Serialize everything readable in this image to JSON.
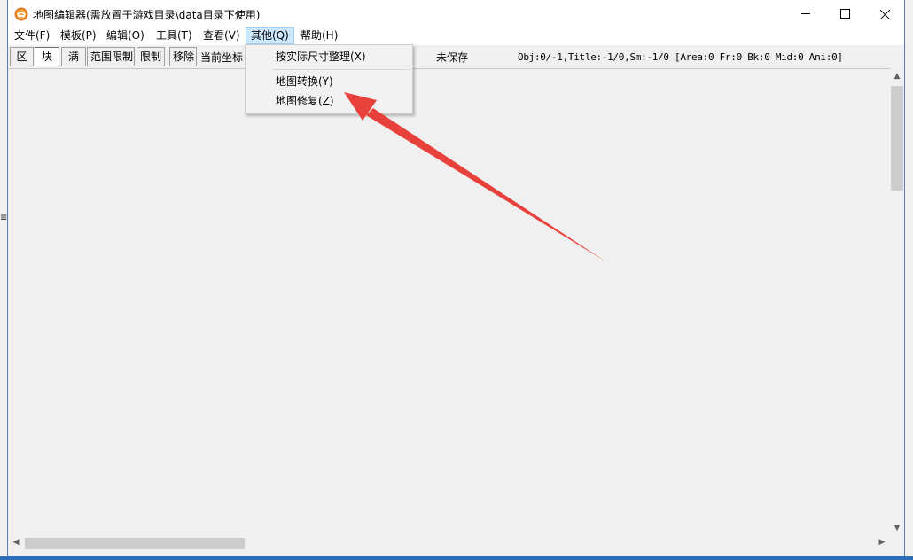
{
  "window": {
    "title": "地图编辑器(需放置于游戏目录\\data目录下使用)",
    "app_icon": "app-logo-icon",
    "controls": {
      "minimize_icon": "minimize-icon",
      "maximize_icon": "maximize-icon",
      "close_icon": "close-icon"
    }
  },
  "menubar": {
    "items": [
      {
        "label": "文件(F)"
      },
      {
        "label": "模板(P)"
      },
      {
        "label": "编辑(O)"
      },
      {
        "label": "工具(T)"
      },
      {
        "label": "查看(V)"
      },
      {
        "label": "其他(Q)",
        "active": true
      },
      {
        "label": "帮助(H)"
      }
    ]
  },
  "toolbar": {
    "buttons": [
      {
        "label": "区"
      },
      {
        "label": "块",
        "pressed": true
      },
      {
        "label": "满"
      },
      {
        "label": "范围限制"
      },
      {
        "label": "限制"
      },
      {
        "label": "移除"
      }
    ],
    "coord_label": "当前坐标",
    "save_status": "未保存",
    "stats": "Obj:0/-1,Title:-1/0,Sm:-1/0 [Area:0 Fr:0 Bk:0 Mid:0 Ani:0]"
  },
  "dropdown": {
    "open_menu": "其他(Q)",
    "items": [
      {
        "label": "按实际尺寸整理(X)"
      },
      {
        "label": "地图转换(Y)"
      },
      {
        "label": "地图修复(Z)"
      }
    ]
  },
  "annotation": {
    "color": "#e8413c",
    "target": "地图转换(Y)"
  },
  "colors": {
    "menu_active_bg": "#cce8ff",
    "canvas_bg": "#f0f0f0",
    "taskbar": "#2c6cb8"
  }
}
